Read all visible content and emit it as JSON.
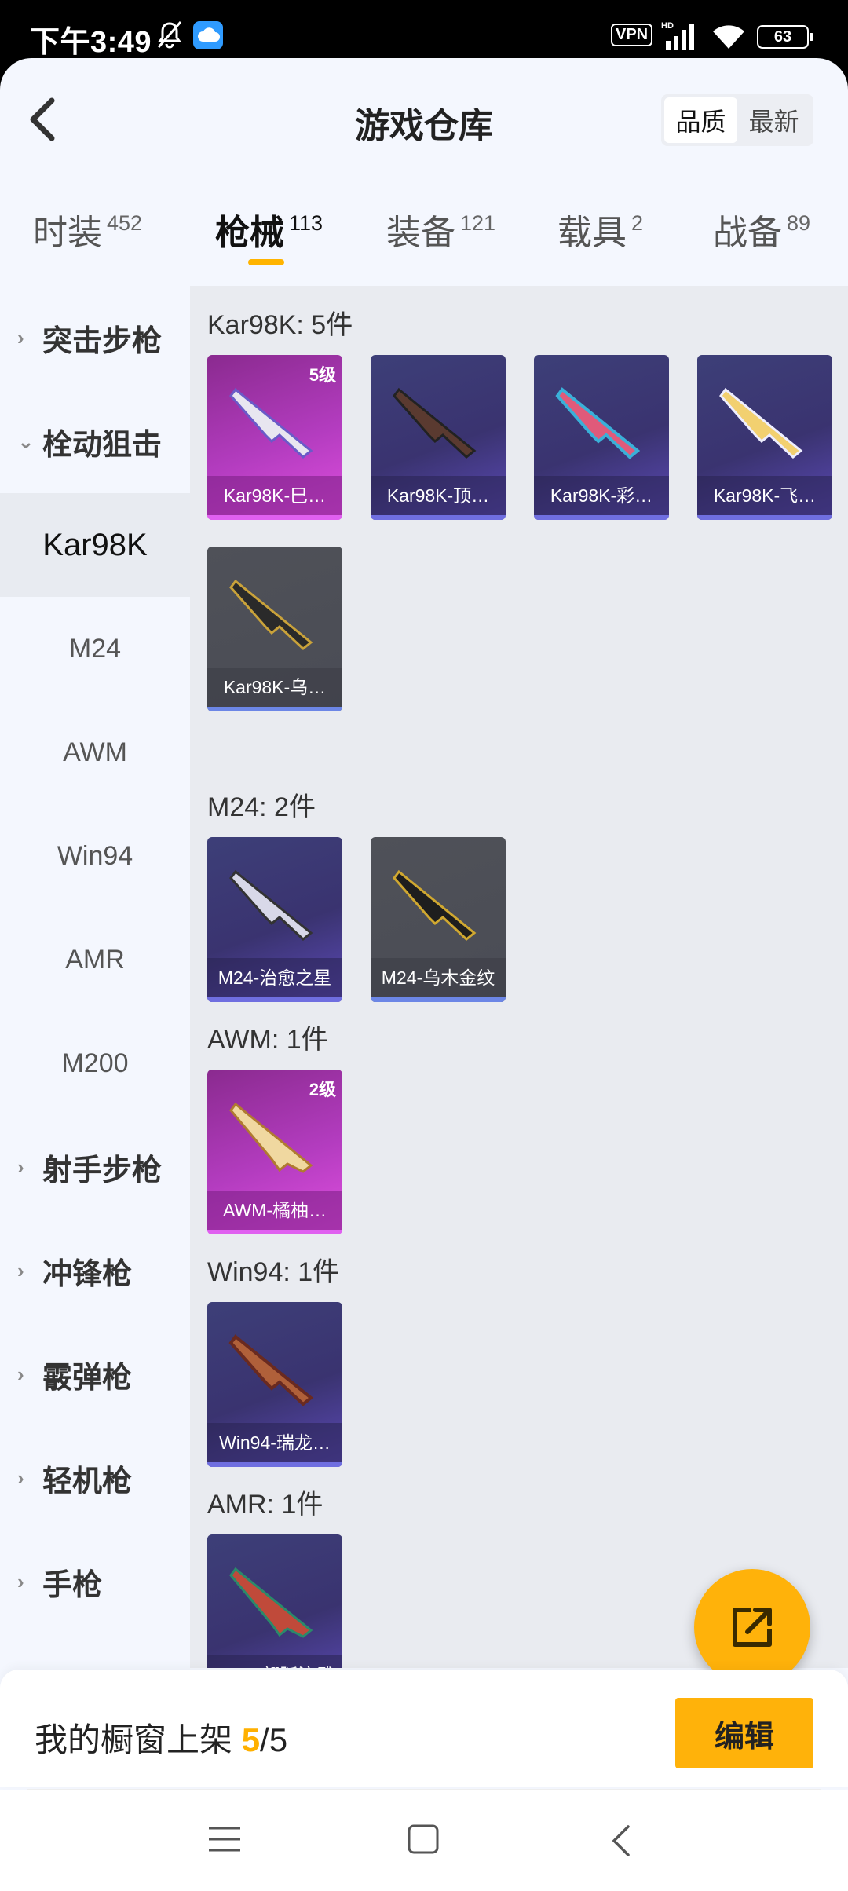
{
  "status_bar": {
    "time": "下午3:49",
    "vpn": "VPN",
    "battery": "63"
  },
  "header": {
    "title": "游戏仓库",
    "sort_options": [
      "品质",
      "最新"
    ],
    "active_sort": "品质"
  },
  "tabs": [
    {
      "name": "时装",
      "count": "452"
    },
    {
      "name": "枪械",
      "count": "113"
    },
    {
      "name": "装备",
      "count": "121"
    },
    {
      "name": "载具",
      "count": "2"
    },
    {
      "name": "战备",
      "count": "89"
    }
  ],
  "active_tab": "枪械",
  "sidebar": {
    "categories": [
      {
        "label": "突击步枪",
        "expanded": false
      },
      {
        "label": "栓动狙击",
        "expanded": true
      },
      {
        "label": "射手步枪",
        "expanded": false
      },
      {
        "label": "冲锋枪",
        "expanded": false
      },
      {
        "label": "霰弹枪",
        "expanded": false
      },
      {
        "label": "轻机枪",
        "expanded": false
      },
      {
        "label": "手枪",
        "expanded": false
      }
    ],
    "sub_items": [
      "Kar98K",
      "M24",
      "AWM",
      "Win94",
      "AMR",
      "M200"
    ],
    "active_sub": "Kar98K"
  },
  "groups": [
    {
      "title": "Kar98K: 5件",
      "items": [
        {
          "label": "Kar98K-巳…",
          "rarity": "pink",
          "level": "5级"
        },
        {
          "label": "Kar98K-顶…",
          "rarity": "purple"
        },
        {
          "label": "Kar98K-彩…",
          "rarity": "purple"
        },
        {
          "label": "Kar98K-飞…",
          "rarity": "purple"
        },
        {
          "label": "Kar98K-乌…",
          "rarity": "gray"
        }
      ]
    },
    {
      "title": "M24: 2件",
      "items": [
        {
          "label": "M24-治愈之星",
          "rarity": "purple"
        },
        {
          "label": "M24-乌木金纹",
          "rarity": "gray"
        }
      ]
    },
    {
      "title": "AWM: 1件",
      "items": [
        {
          "label": "AWM-橘柚…",
          "rarity": "pink",
          "level": "2级"
        }
      ]
    },
    {
      "title": "Win94: 1件",
      "items": [
        {
          "label": "Win94-瑞龙…",
          "rarity": "purple"
        }
      ]
    },
    {
      "title": "AMR: 1件",
      "items": [
        {
          "label": "AMR-翩跹演武",
          "rarity": "purple"
        }
      ]
    }
  ],
  "shelf": {
    "label": "我的橱窗上架",
    "current": "5",
    "total": "/5",
    "edit_label": "编辑"
  },
  "colors": {
    "accent": "#ffb20a",
    "rarity_pink": "#c23fcf",
    "rarity_purple": "#3d3a78",
    "rarity_gray": "#4f5158"
  },
  "icons": [
    "bell-off-icon",
    "cloud-icon",
    "signal-icon",
    "wifi-icon",
    "back-icon",
    "share-icon",
    "menu-icon",
    "home-icon",
    "nav-back-icon"
  ]
}
